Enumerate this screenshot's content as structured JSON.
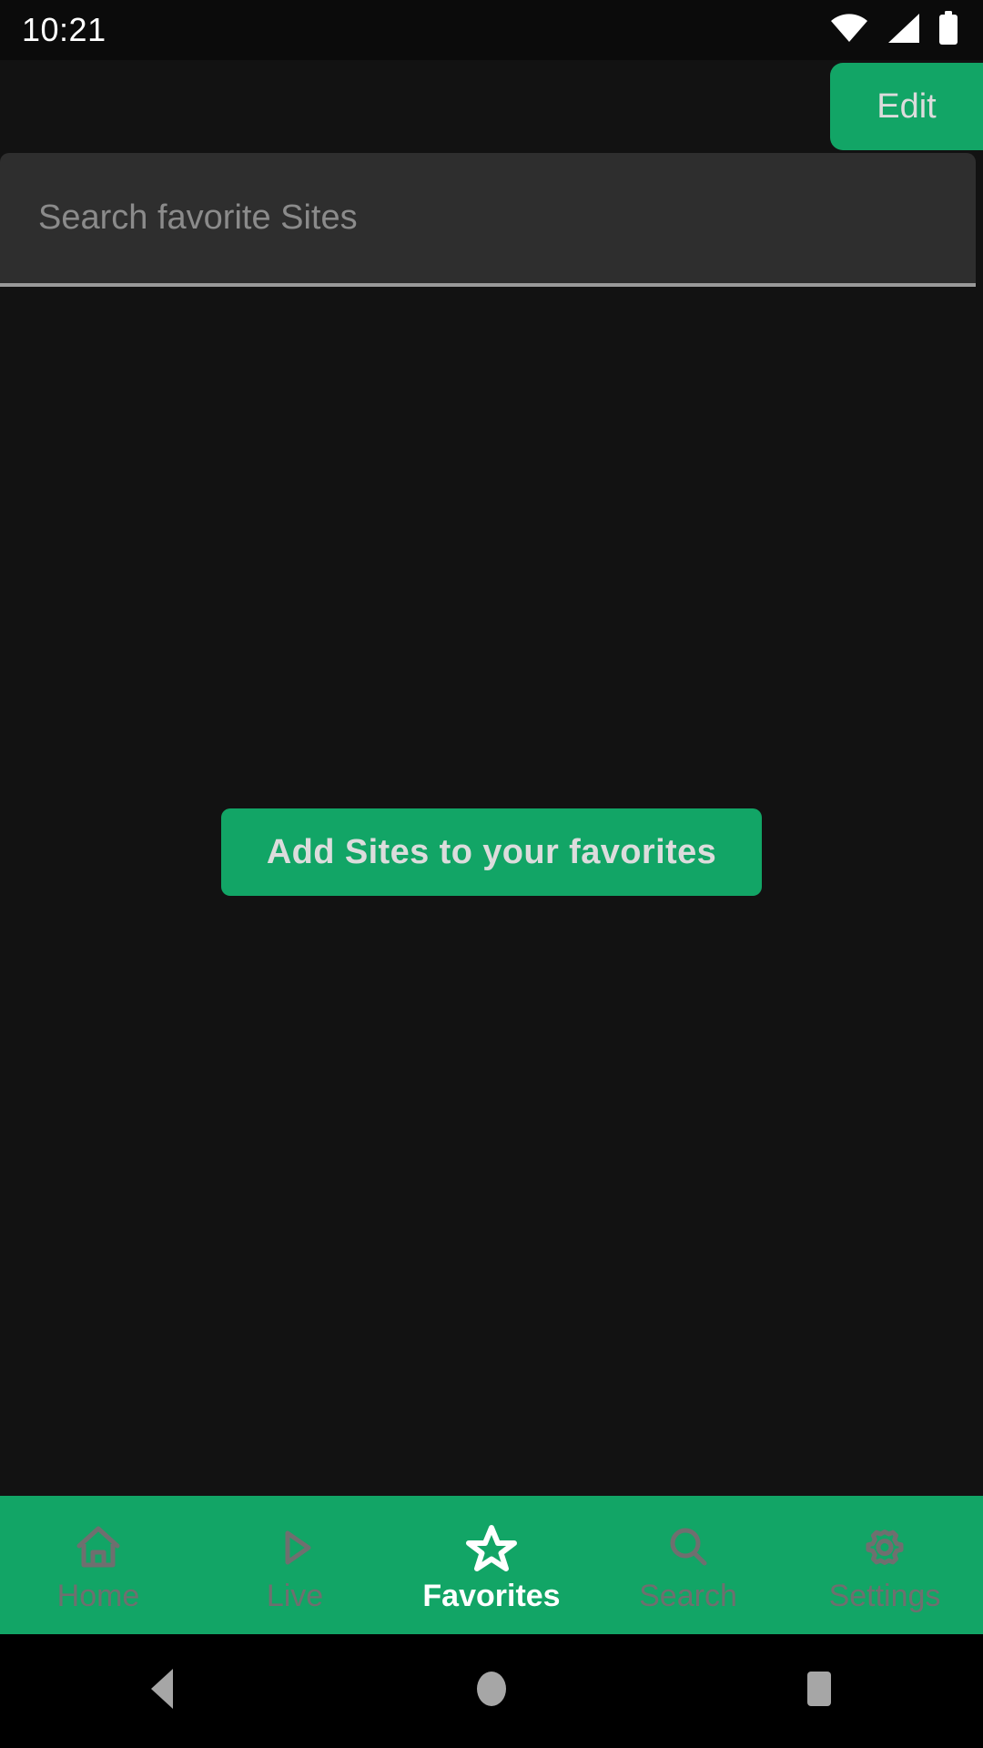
{
  "status_bar": {
    "clock": "10:21",
    "icons": [
      {
        "name": "wifi-icon",
        "label": "Wi-Fi"
      },
      {
        "name": "cellular-signal-icon",
        "label": "Cellular signal"
      },
      {
        "name": "battery-icon",
        "label": "Battery"
      }
    ]
  },
  "header": {
    "edit_label": "Edit"
  },
  "search": {
    "placeholder": "Search favorite Sites",
    "value": ""
  },
  "main": {
    "add_favorites_label": "Add Sites to your favorites"
  },
  "tab_bar": {
    "items": [
      {
        "label": "Home",
        "icon": "home-icon",
        "active": false
      },
      {
        "label": "Live",
        "icon": "play-icon",
        "active": false
      },
      {
        "label": "Favorites",
        "icon": "star-icon",
        "active": true
      },
      {
        "label": "Search",
        "icon": "search-icon",
        "active": false
      },
      {
        "label": "Settings",
        "icon": "gear-icon",
        "active": false
      }
    ]
  },
  "system_nav": {
    "buttons": [
      {
        "label": "Back",
        "icon": "back-triangle-icon"
      },
      {
        "label": "Home",
        "icon": "home-circle-icon"
      },
      {
        "label": "Recent apps",
        "icon": "recents-square-icon"
      }
    ]
  },
  "colors": {
    "accent_green": "#12a566",
    "screen_background": "#121212",
    "status_bar_background": "#0b0b0b",
    "search_field_background": "#2e2e2e",
    "search_underline": "#9a9a9a",
    "inactive_tab": "#6f6f6f",
    "active_tab": "#ffffff",
    "button_text": "#dcdcdc",
    "placeholder_text": "#8b8b8b",
    "system_nav_icon": "#a6a6a6"
  }
}
